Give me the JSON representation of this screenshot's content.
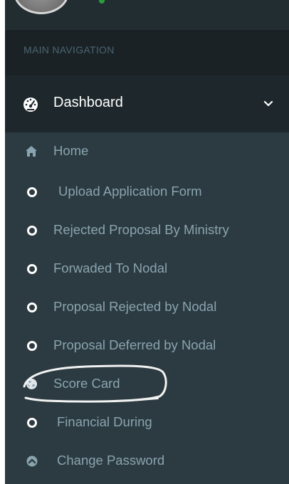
{
  "sidebar": {
    "header_label": "MAIN NAVIGATION",
    "dashboard": {
      "label": "Dashboard",
      "icon": "dashboard-icon"
    },
    "items": [
      {
        "label": "Home",
        "icon": "home-icon"
      },
      {
        "label": "Upload Application Form",
        "icon": "circle-o-icon"
      },
      {
        "label": "Rejected Proposal By Ministry",
        "icon": "circle-o-icon"
      },
      {
        "label": "Forwaded To Nodal",
        "icon": "circle-o-icon"
      },
      {
        "label": "Proposal Rejected by Nodal",
        "icon": "circle-o-icon"
      },
      {
        "label": "Proposal Deferred by Nodal",
        "icon": "circle-o-icon"
      },
      {
        "label": "Score Card",
        "icon": "globe-icon"
      },
      {
        "label": "Financial During",
        "icon": "circle-o-icon"
      },
      {
        "label": "Change Password",
        "icon": "arrow-circle-up-icon"
      }
    ]
  },
  "colors": {
    "sidebar_bg": "#222d32",
    "header_bg": "#1a2226",
    "submenu_bg": "#2c3b41",
    "submenu_text": "#8aa4af",
    "header_text": "#4b646f",
    "active_text": "#ffffff"
  }
}
